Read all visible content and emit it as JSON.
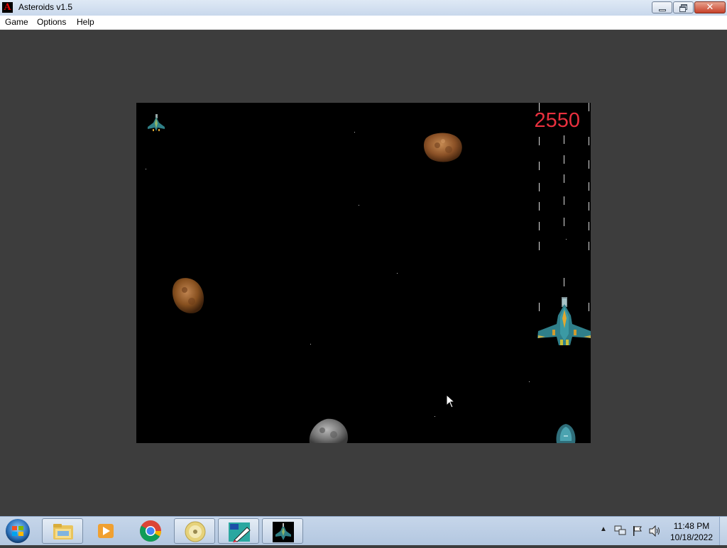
{
  "window": {
    "title": "Asteroids v1.5",
    "icon": "asteroids-app-icon",
    "icon_letter": "A"
  },
  "menu": [
    "Game",
    "Options",
    "Help"
  ],
  "game": {
    "score": "2550",
    "lives_remaining": 1,
    "colors": {
      "background": "#000000",
      "score": "#e8303e"
    }
  },
  "taskbar": {
    "items": [
      "windows-explorer-icon",
      "media-player-icon",
      "chrome-icon",
      "dvd-icon",
      "paint-app-icon",
      "asteroids-game-icon"
    ],
    "tray_icons": [
      "show-hidden-icons-arrow",
      "network-icon",
      "action-center-flag-icon",
      "volume-icon"
    ],
    "time": "11:48 PM",
    "date": "10/18/2022"
  }
}
